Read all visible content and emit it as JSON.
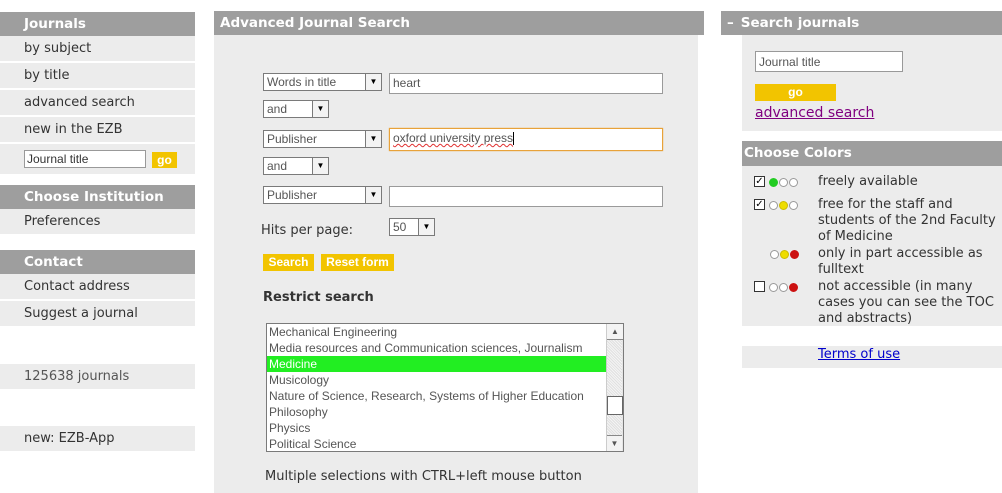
{
  "sidebar": {
    "journals_header": "Journals",
    "nav_items": [
      "by subject",
      "by title",
      "advanced search",
      "new in the EZB"
    ],
    "journal_title_placeholder": "Journal title",
    "go_label": "go",
    "institution_header": "Choose Institution",
    "preferences": "Preferences",
    "contact_header": "Contact",
    "contact_items": [
      "Contact address",
      "Suggest a journal"
    ],
    "journal_count": "125638 journals",
    "app_link": "new: EZB-App"
  },
  "main": {
    "header": "Advanced Journal Search",
    "rows": [
      {
        "field": "Words in title",
        "value": "heart"
      },
      {
        "operator": "and"
      },
      {
        "field": "Publisher",
        "value": "oxford university press"
      },
      {
        "operator": "and"
      },
      {
        "field": "Publisher",
        "value": ""
      }
    ],
    "hits_label": "Hits per page:",
    "hits_value": "50",
    "search_button": "Search",
    "reset_button": "Reset form",
    "restrict_heading": "Restrict search",
    "subjects": [
      "Mechanical Engineering",
      "Media resources and Communication sciences, Journalism",
      "Medicine",
      "Musicology",
      "Nature of Science, Research, Systems of Higher Education",
      "Philosophy",
      "Physics",
      "Political Science"
    ],
    "selected_subject": "Medicine",
    "multi_select_hint": "Multiple selections with CTRL+left mouse button"
  },
  "right": {
    "search_header": "Search journals",
    "collapse_symbol": "–",
    "journal_title_placeholder": "Journal title",
    "go_label": "go",
    "advanced_link": "advanced search",
    "colors_header": "Choose Colors",
    "color_options": [
      {
        "checked": true,
        "label": "freely available",
        "dots": [
          "green",
          "empty",
          "empty"
        ]
      },
      {
        "checked": true,
        "label": "free for the staff and students of the 2nd Faculty of Medicine",
        "dots": [
          "empty",
          "yellow",
          "empty"
        ]
      },
      {
        "checked": null,
        "label": "only in part accessible as fulltext",
        "dots": [
          "empty",
          "yellow",
          "red"
        ]
      },
      {
        "checked": false,
        "label": "not accessible (in many cases you can see the TOC and abstracts)",
        "dots": [
          "empty",
          "empty",
          "red"
        ]
      }
    ],
    "terms_link": "Terms of use"
  },
  "colors": {
    "header_gray": "#9e9e9e",
    "panel_bg": "#ececec",
    "accent_yellow": "#f2c400",
    "selection_green": "#22ee22",
    "link_purple": "#800080",
    "link_blue": "#0000cc",
    "dot_green": "#22cc22",
    "dot_yellow": "#eedd00",
    "dot_red": "#cc1111"
  }
}
